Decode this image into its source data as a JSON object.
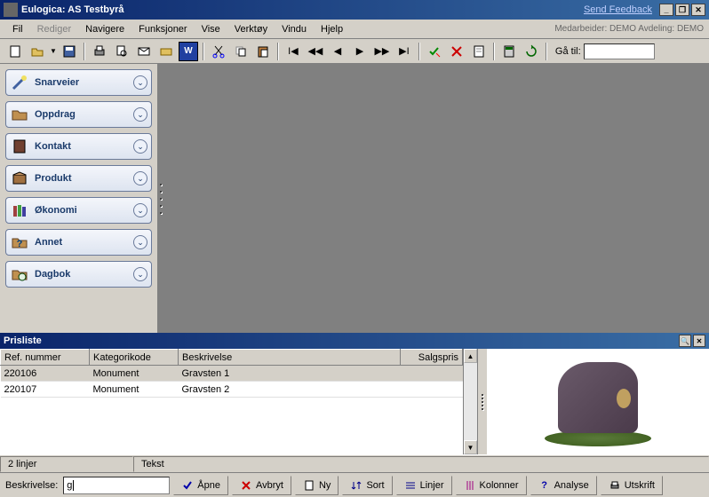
{
  "window": {
    "title": "Eulogica: AS Testbyrå",
    "feedback": "Send Feedback"
  },
  "menu": {
    "items": [
      "Fil",
      "Rediger",
      "Navigere",
      "Funksjoner",
      "Vise",
      "Verktøy",
      "Vindu",
      "Hjelp"
    ],
    "disabled_index": 1,
    "status_right": "Medarbeider: DEMO   Avdeling: DEMO"
  },
  "toolbar": {
    "goto_label": "Gå til:",
    "goto_value": ""
  },
  "sidebar": {
    "items": [
      {
        "label": "Snarveier",
        "icon": "wand"
      },
      {
        "label": "Oppdrag",
        "icon": "folder-doc"
      },
      {
        "label": "Kontakt",
        "icon": "book"
      },
      {
        "label": "Produkt",
        "icon": "box"
      },
      {
        "label": "Økonomi",
        "icon": "books"
      },
      {
        "label": "Annet",
        "icon": "folder-q"
      },
      {
        "label": "Dagbok",
        "icon": "folder-clock"
      }
    ]
  },
  "panel": {
    "title": "Prisliste",
    "columns": [
      "Ref. nummer",
      "Kategorikode",
      "Beskrivelse",
      "Salgspris"
    ],
    "rows": [
      {
        "ref": "220106",
        "kat": "Monument",
        "besk": "Gravsten 1",
        "pris": ""
      },
      {
        "ref": "220107",
        "kat": "Monument",
        "besk": "Gravsten 2",
        "pris": ""
      }
    ],
    "selected_row": 0,
    "status_left": "2 linjer",
    "status_right_label": "Tekst",
    "search_label": "Beskrivelse:",
    "search_value": "g",
    "buttons": {
      "open": "Åpne",
      "cancel": "Avbryt",
      "new": "Ny",
      "sort": "Sort",
      "lines": "Linjer",
      "columns": "Kolonner",
      "analyse": "Analyse",
      "print": "Utskrift"
    }
  }
}
